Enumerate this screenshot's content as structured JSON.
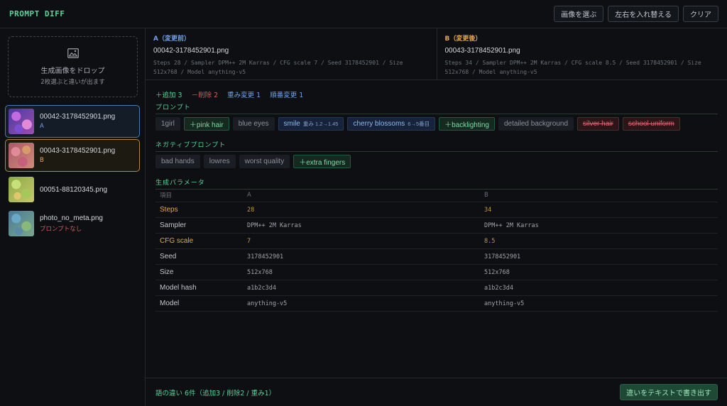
{
  "app": {
    "title": "PROMPT DIFF"
  },
  "header": {
    "actions": [
      {
        "label": "画像を選ぶ"
      },
      {
        "label": "左右を入れ替える"
      },
      {
        "label": "クリア"
      }
    ]
  },
  "dropzone": {
    "icon": "image-icon",
    "title": "生成画像をドロップ",
    "subtitle": "2枚選ぶと違いが出ます"
  },
  "files": [
    {
      "name": "00042-3178452901.png",
      "tag": "A",
      "selected": "A",
      "tag_color": "#6fa0e8"
    },
    {
      "name": "00043-3178452901.png",
      "tag": "B",
      "selected": "B",
      "tag_color": "#e5a94a"
    },
    {
      "name": "00051-88120345.png",
      "tag": "",
      "selected": ""
    },
    {
      "name": "photo_no_meta.png",
      "tag": "プロンプトなし",
      "selected": "",
      "tag_color": "#e0555c"
    }
  ],
  "compare": {
    "a": {
      "label": "A（変更前）",
      "color": "#6fa0e8",
      "file": "00042-3178452901.png",
      "params": "Steps 28 / Sampler DPM++ 2M Karras / CFG scale 7 / Seed 3178452901 / Size 512x768 / Model anything-v5"
    },
    "b": {
      "label": "B（変更後）",
      "color": "#e5a94a",
      "file": "00043-3178452901.png",
      "params": "Steps 34 / Sampler DPM++ 2M Karras / CFG scale 8.5 / Seed 3178452901 / Size 512x768 / Model anything-v5"
    }
  },
  "summary": {
    "added": "＋追加 3",
    "removed": "－削除 2",
    "weight": "重み変更 1",
    "order": "順番変更 1",
    "colors": {
      "added": "#56d39a",
      "removed": "#e0555c",
      "weight": "#6fa0e8",
      "order": "#6fa0e8"
    }
  },
  "prompt": {
    "title": "プロンプト",
    "tokens": [
      {
        "text": "1girl",
        "type": "same"
      },
      {
        "text": "＋pink hair",
        "type": "add"
      },
      {
        "text": "blue eyes",
        "type": "same"
      },
      {
        "text": "smile",
        "type": "wt",
        "sub": "重み 1.2→1.45"
      },
      {
        "text": "cherry blossoms",
        "type": "wt",
        "sub": "6→5番目"
      },
      {
        "text": "＋backlighting",
        "type": "add"
      },
      {
        "text": "detailed background",
        "type": "same"
      },
      {
        "text": "silver hair",
        "type": "del"
      },
      {
        "text": "school uniform",
        "type": "del"
      }
    ]
  },
  "negative": {
    "title": "ネガティブプロンプト",
    "tokens": [
      {
        "text": "bad hands",
        "type": "same"
      },
      {
        "text": "lowres",
        "type": "same"
      },
      {
        "text": "worst quality",
        "type": "same"
      },
      {
        "text": "＋extra fingers",
        "type": "add"
      }
    ]
  },
  "params": {
    "title": "生成パラメータ",
    "headers": [
      "項目",
      "A",
      "B"
    ],
    "rows": [
      {
        "key": "Steps",
        "a": "28",
        "b": "34",
        "changed": true
      },
      {
        "key": "Sampler",
        "a": "DPM++ 2M Karras",
        "b": "DPM++ 2M Karras",
        "changed": false
      },
      {
        "key": "CFG scale",
        "a": "7",
        "b": "8.5",
        "changed": true
      },
      {
        "key": "Seed",
        "a": "3178452901",
        "b": "3178452901",
        "changed": false
      },
      {
        "key": "Size",
        "a": "512x768",
        "b": "512x768",
        "changed": false
      },
      {
        "key": "Model hash",
        "a": "a1b2c3d4",
        "b": "a1b2c3d4",
        "changed": false
      },
      {
        "key": "Model",
        "a": "anything-v5",
        "b": "anything-v5",
        "changed": false
      }
    ]
  },
  "footer": {
    "summary": "語の違い 6件（追加3 / 削除2 / 重み1）",
    "export_label": "違いをテキストで書き出す"
  }
}
